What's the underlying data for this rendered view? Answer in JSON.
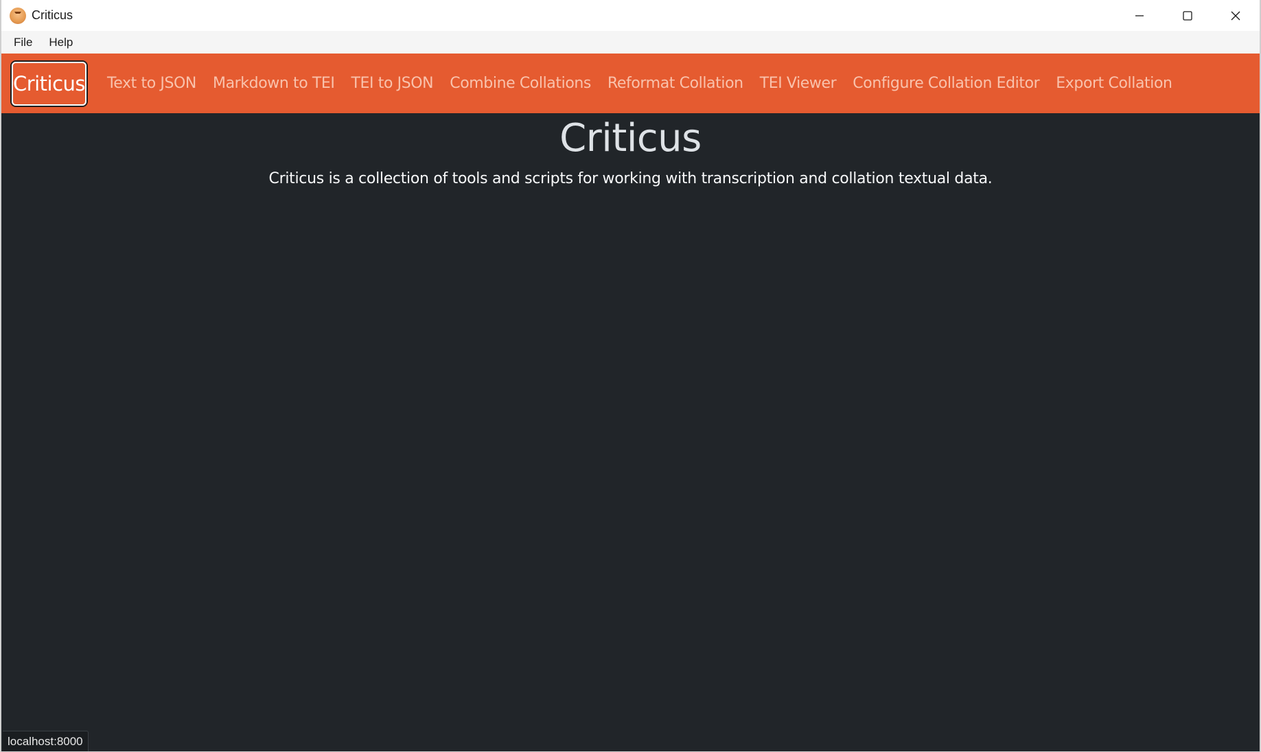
{
  "window": {
    "title": "Criticus",
    "icon": "criticus-app-icon",
    "controls": {
      "minimize_icon": "minimize-icon",
      "maximize_icon": "maximize-icon",
      "close_icon": "close-icon"
    }
  },
  "menubar": {
    "items": [
      {
        "label": "File"
      },
      {
        "label": "Help"
      }
    ]
  },
  "navbar": {
    "brand": "Criticus",
    "links": [
      {
        "label": "Text to JSON"
      },
      {
        "label": "Markdown to TEI"
      },
      {
        "label": "TEI to JSON"
      },
      {
        "label": "Combine Collations"
      },
      {
        "label": "Reformat Collation"
      },
      {
        "label": "TEI Viewer"
      },
      {
        "label": "Configure Collation Editor"
      },
      {
        "label": "Export Collation"
      }
    ],
    "colors": {
      "background": "#e55b30",
      "link": "#f9c2ac",
      "brand": "#ffffff"
    }
  },
  "main": {
    "title": "Criticus",
    "description": "Criticus is a collection of tools and scripts for working with transcription and collation textual data.",
    "background": "#212529"
  },
  "status": {
    "url": "localhost:8000"
  }
}
